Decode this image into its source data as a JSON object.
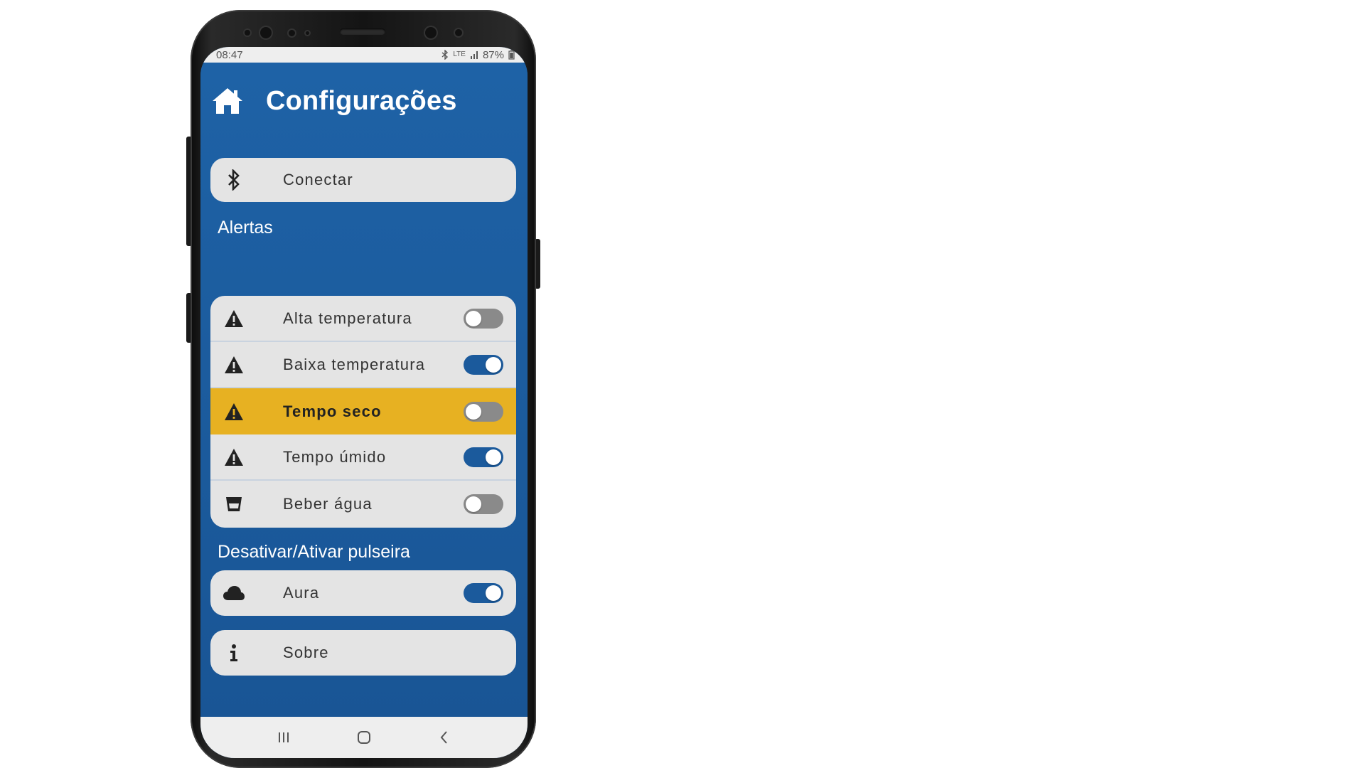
{
  "status_bar": {
    "time": "08:47",
    "network": "LTE",
    "battery": "87%"
  },
  "header": {
    "title": "Configurações",
    "icon": "home-icon"
  },
  "connect": {
    "label": "Conectar",
    "icon": "bluetooth-icon"
  },
  "alerts": {
    "section_title": "Alertas",
    "items": [
      {
        "label": "Alta temperatura",
        "icon": "warning-icon",
        "enabled": false
      },
      {
        "label": "Baixa temperatura",
        "icon": "warning-icon",
        "enabled": true
      },
      {
        "label": "Tempo seco",
        "icon": "warning-icon",
        "enabled": false
      },
      {
        "label": "Tempo úmido",
        "icon": "warning-icon",
        "enabled": true
      },
      {
        "label": "Beber água",
        "icon": "glass-icon",
        "enabled": false
      }
    ]
  },
  "bracelet": {
    "section_title": "Desativar/Ativar pulseira",
    "item": {
      "label": "Aura",
      "icon": "cloud-icon",
      "enabled": true
    }
  },
  "about": {
    "label": "Sobre",
    "icon": "info-icon"
  },
  "colors": {
    "primary": "#1b5a9c",
    "highlight": "#e7b122",
    "card": "#e4e4e4"
  }
}
